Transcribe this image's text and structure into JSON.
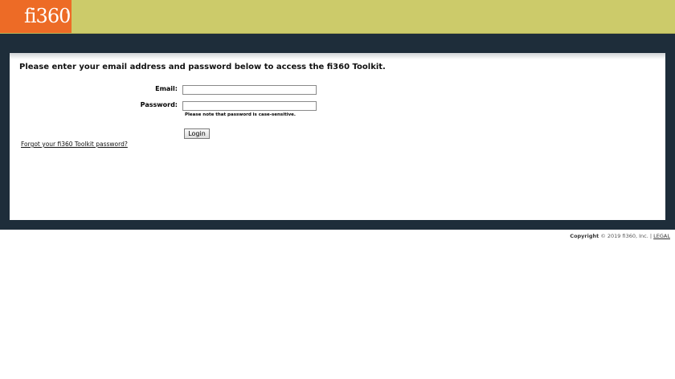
{
  "header": {
    "logo_text": "fi360",
    "logo_tm": "®",
    "colors": {
      "bar": "#cccb6a",
      "logo": "#ed6b26",
      "band": "#1e2d3a"
    }
  },
  "login": {
    "intro": "Please enter your email address and password below to access the fi360 Toolkit.",
    "email_label": "Email:",
    "email_value": "",
    "password_label": "Password:",
    "password_value": "",
    "note": "Please note that password is case-sensitive.",
    "login_button": "Login",
    "forgot_link": "Forgot your fi360 Toolkit password?"
  },
  "footer": {
    "copyright_label": "Copyright",
    "copyright_text": "© 2019 fi360, Inc. |",
    "legal_link": "LEGAL"
  }
}
